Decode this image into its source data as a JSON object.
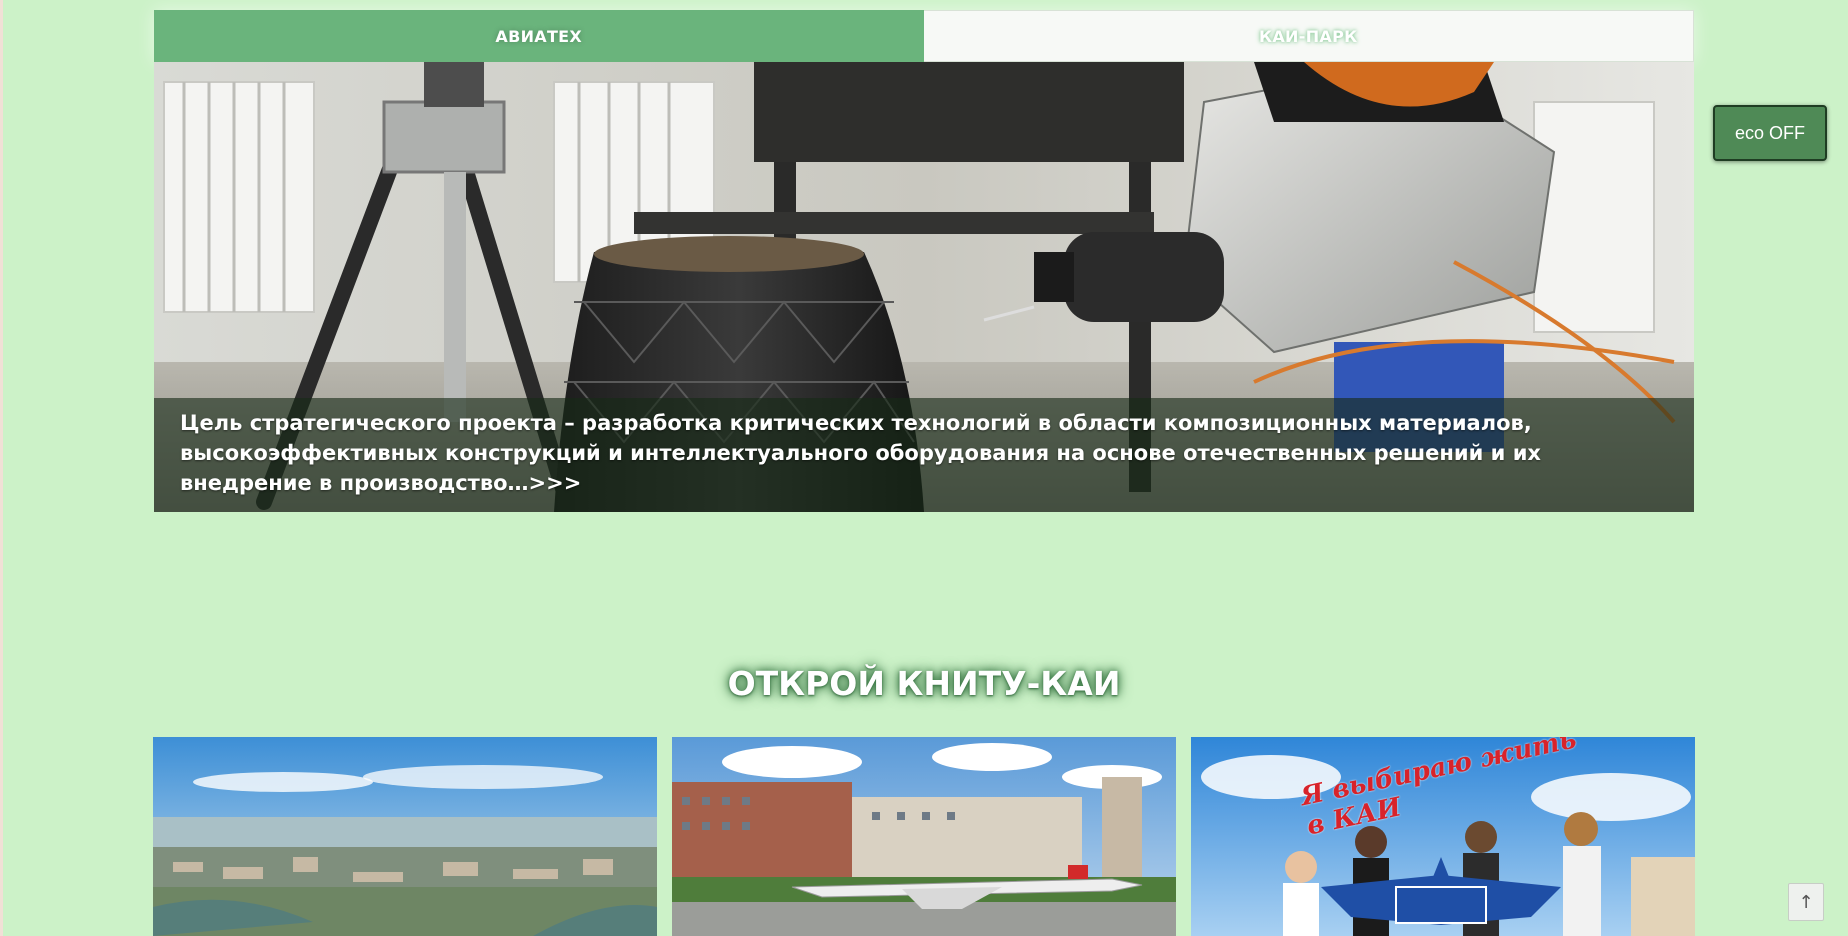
{
  "tabs": [
    {
      "label": "АВИАТЕХ",
      "active": true
    },
    {
      "label": "КАИ-ПАРК",
      "active": false
    }
  ],
  "slide": {
    "caption": "Цель стратегического проекта – разработка критических технологий в области композиционных материалов, высокоэффективных конструкций и интеллектуального оборудования на основе отечественных решений и их внедрение в производство…>>>"
  },
  "eco_toggle": {
    "label": "eco OFF"
  },
  "section": {
    "title": "ОТКРОЙ КНИТУ-КАИ"
  },
  "cards": [
    {
      "subject": "city-aerial"
    },
    {
      "subject": "tu-144-monument"
    },
    {
      "subject": "students-poster",
      "poster_text": "Я выбираю жить в КАИ"
    }
  ],
  "scroll_top": {
    "label": "↑"
  },
  "colors": {
    "page_bg": "#ccf2c8",
    "tab_active": "#6ab47c",
    "eco_button": "#4f8a56"
  }
}
